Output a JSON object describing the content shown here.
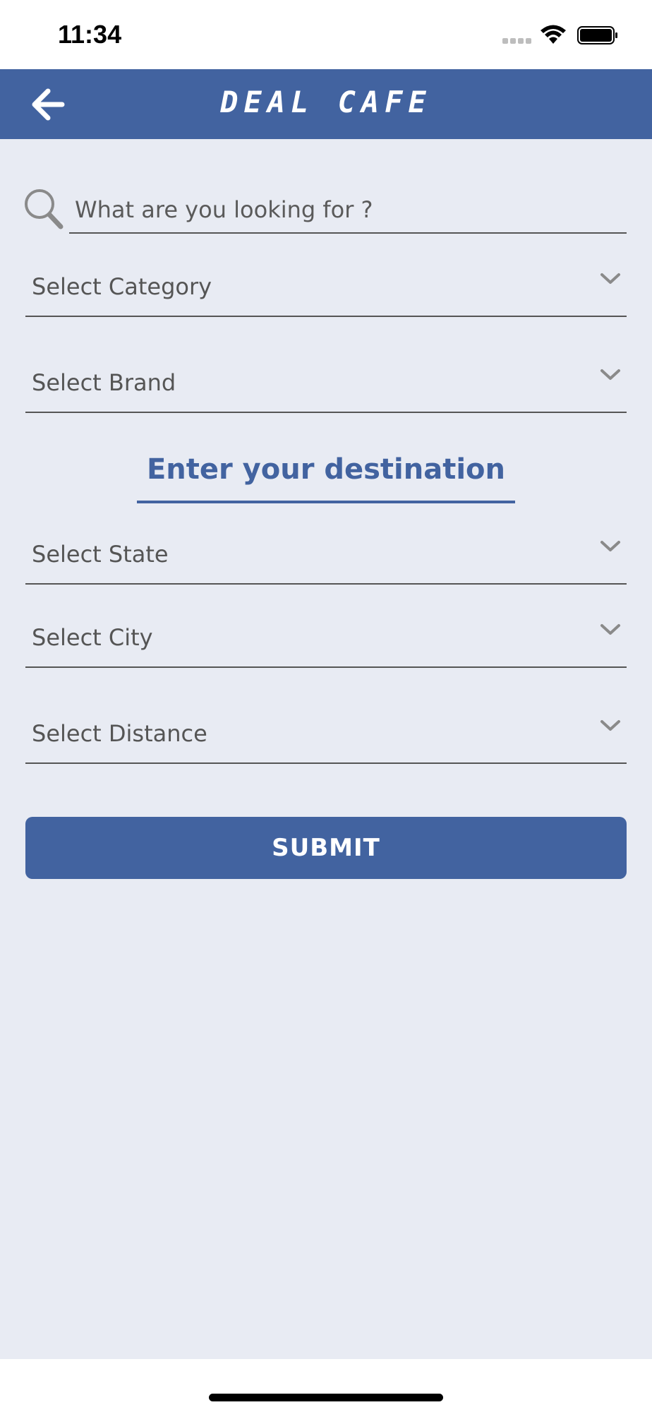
{
  "status_bar": {
    "time": "11:34"
  },
  "header": {
    "title": "DEAL CAFE",
    "background_color": "#4263a0",
    "back_icon": "arrow-left-icon"
  },
  "search": {
    "placeholder": "What are you looking for ?",
    "icon": "search-icon"
  },
  "filters": {
    "category_label": "Select Category",
    "brand_label": "Select Brand"
  },
  "destination": {
    "heading": "Enter your destination",
    "state_label": "Select State",
    "city_label": "Select City",
    "distance_label": "Select Distance"
  },
  "actions": {
    "submit_label": "SUBMIT"
  },
  "colors": {
    "accent": "#4263a0",
    "content_background": "#e8ebf3"
  }
}
